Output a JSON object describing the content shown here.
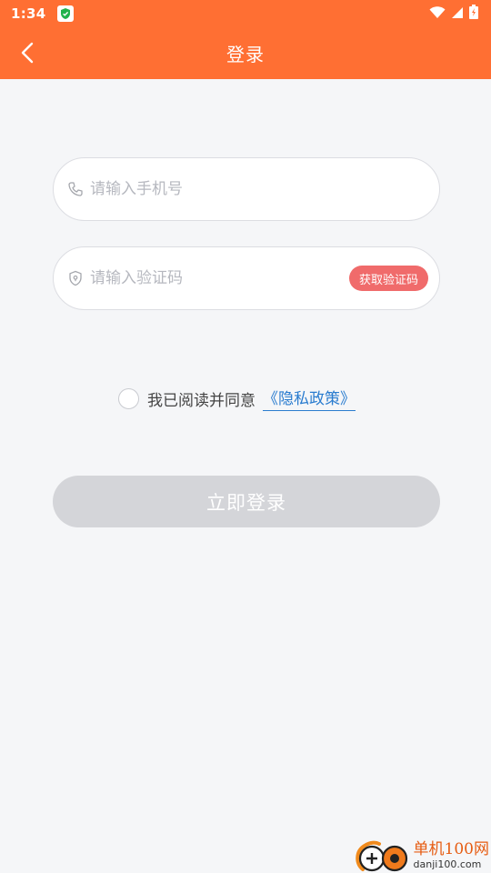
{
  "status_bar": {
    "time": "1:34"
  },
  "header": {
    "title": "登录"
  },
  "form": {
    "phone": {
      "placeholder": "请输入手机号",
      "value": ""
    },
    "code": {
      "placeholder": "请输入验证码",
      "value": "",
      "button_label": "获取验证码"
    }
  },
  "agreement": {
    "text": "我已阅读并同意",
    "link": "《隐私政策》",
    "checked": false
  },
  "login_button": {
    "label": "立即登录"
  },
  "watermark": {
    "name": "单机100网",
    "url": "danji100.com"
  },
  "colors": {
    "header": "#ff6f33",
    "code_button": "#f06b6b",
    "link": "#2a7ccf",
    "disabled_button": "#d4d5d9"
  }
}
